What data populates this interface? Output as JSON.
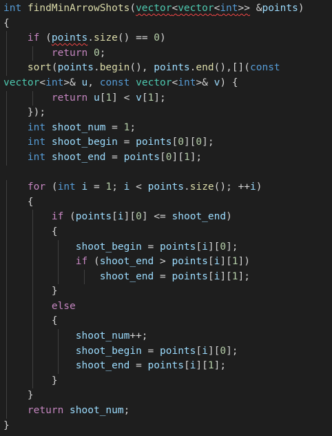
{
  "editor": {
    "language": "cpp",
    "theme": "dark",
    "colors": {
      "background": "#1e1e1e",
      "keyword": "#c586c0",
      "type": "#569cd6",
      "function": "#dcdcaa",
      "variable": "#9cdcfe",
      "number": "#b5cea8",
      "template": "#4ec9b0",
      "text": "#d4d4d4",
      "error_squiggle": "#f44747"
    },
    "lines": [
      {
        "indent": 0,
        "tokens": [
          [
            "type",
            "int"
          ],
          [
            "pun",
            " "
          ],
          [
            "fn",
            "findMinArrowShots"
          ],
          [
            "pun",
            "("
          ],
          [
            "tpl",
            "vector",
            "err"
          ],
          [
            "pun",
            "<",
            "err"
          ],
          [
            "tpl",
            "vector",
            "err"
          ],
          [
            "pun",
            "<",
            "err"
          ],
          [
            "type",
            "int",
            "err"
          ],
          [
            "pun",
            ">>",
            "err"
          ],
          [
            "pun",
            " &"
          ],
          [
            "var",
            "points"
          ],
          [
            "pun",
            ")"
          ]
        ]
      },
      {
        "indent": 0,
        "tokens": [
          [
            "pun",
            "{"
          ]
        ]
      },
      {
        "indent": 1,
        "tokens": [
          [
            "kw",
            "if"
          ],
          [
            "pun",
            " ("
          ],
          [
            "var",
            "points",
            "err"
          ],
          [
            "pun",
            "."
          ],
          [
            "fn",
            "size"
          ],
          [
            "pun",
            "() == "
          ],
          [
            "num",
            "0"
          ],
          [
            "pun",
            ")"
          ]
        ]
      },
      {
        "indent": 2,
        "tokens": [
          [
            "kw",
            "return"
          ],
          [
            "pun",
            " "
          ],
          [
            "num",
            "0"
          ],
          [
            "pun",
            ";"
          ]
        ]
      },
      {
        "indent": 1,
        "tokens": [
          [
            "fn",
            "sort"
          ],
          [
            "pun",
            "("
          ],
          [
            "var",
            "points"
          ],
          [
            "pun",
            "."
          ],
          [
            "fn",
            "begin"
          ],
          [
            "pun",
            "(), "
          ],
          [
            "var",
            "points"
          ],
          [
            "pun",
            "."
          ],
          [
            "fn",
            "end"
          ],
          [
            "pun",
            "(),[]("
          ],
          [
            "type",
            "const"
          ]
        ]
      },
      {
        "indent": 0,
        "tokens": [
          [
            "tpl",
            "vector"
          ],
          [
            "pun",
            "<"
          ],
          [
            "type",
            "int"
          ],
          [
            "pun",
            ">& "
          ],
          [
            "var",
            "u"
          ],
          [
            "pun",
            ", "
          ],
          [
            "type",
            "const"
          ],
          [
            "pun",
            " "
          ],
          [
            "tpl",
            "vector"
          ],
          [
            "pun",
            "<"
          ],
          [
            "type",
            "int"
          ],
          [
            "pun",
            ">& "
          ],
          [
            "var",
            "v"
          ],
          [
            "pun",
            ") {"
          ]
        ]
      },
      {
        "indent": 2,
        "tokens": [
          [
            "kw",
            "return"
          ],
          [
            "pun",
            " "
          ],
          [
            "var",
            "u"
          ],
          [
            "pun",
            "["
          ],
          [
            "num",
            "1"
          ],
          [
            "pun",
            "] < "
          ],
          [
            "var",
            "v"
          ],
          [
            "pun",
            "["
          ],
          [
            "num",
            "1"
          ],
          [
            "pun",
            "];"
          ]
        ]
      },
      {
        "indent": 1,
        "tokens": [
          [
            "pun",
            "});"
          ]
        ]
      },
      {
        "indent": 1,
        "tokens": [
          [
            "type",
            "int"
          ],
          [
            "pun",
            " "
          ],
          [
            "var",
            "shoot_num"
          ],
          [
            "pun",
            " = "
          ],
          [
            "num",
            "1"
          ],
          [
            "pun",
            ";"
          ]
        ]
      },
      {
        "indent": 1,
        "tokens": [
          [
            "type",
            "int"
          ],
          [
            "pun",
            " "
          ],
          [
            "var",
            "shoot_begin"
          ],
          [
            "pun",
            " = "
          ],
          [
            "var",
            "points"
          ],
          [
            "pun",
            "["
          ],
          [
            "num",
            "0"
          ],
          [
            "pun",
            "]["
          ],
          [
            "num",
            "0"
          ],
          [
            "pun",
            "];"
          ]
        ]
      },
      {
        "indent": 1,
        "tokens": [
          [
            "type",
            "int"
          ],
          [
            "pun",
            " "
          ],
          [
            "var",
            "shoot_end"
          ],
          [
            "pun",
            " = "
          ],
          [
            "var",
            "points"
          ],
          [
            "pun",
            "["
          ],
          [
            "num",
            "0"
          ],
          [
            "pun",
            "]["
          ],
          [
            "num",
            "1"
          ],
          [
            "pun",
            "];"
          ]
        ]
      },
      {
        "indent": 0,
        "tokens": []
      },
      {
        "indent": 1,
        "tokens": [
          [
            "kw",
            "for"
          ],
          [
            "pun",
            " ("
          ],
          [
            "type",
            "int"
          ],
          [
            "pun",
            " "
          ],
          [
            "var",
            "i"
          ],
          [
            "pun",
            " = "
          ],
          [
            "num",
            "1"
          ],
          [
            "pun",
            "; "
          ],
          [
            "var",
            "i"
          ],
          [
            "pun",
            " < "
          ],
          [
            "var",
            "points"
          ],
          [
            "pun",
            "."
          ],
          [
            "fn",
            "size"
          ],
          [
            "pun",
            "(); ++"
          ],
          [
            "var",
            "i"
          ],
          [
            "pun",
            ")"
          ]
        ]
      },
      {
        "indent": 1,
        "tokens": [
          [
            "pun",
            "{"
          ]
        ]
      },
      {
        "indent": 2,
        "tokens": [
          [
            "kw",
            "if"
          ],
          [
            "pun",
            " ("
          ],
          [
            "var",
            "points"
          ],
          [
            "pun",
            "["
          ],
          [
            "var",
            "i"
          ],
          [
            "pun",
            "]["
          ],
          [
            "num",
            "0"
          ],
          [
            "pun",
            "] <= "
          ],
          [
            "var",
            "shoot_end"
          ],
          [
            "pun",
            ")"
          ]
        ]
      },
      {
        "indent": 2,
        "tokens": [
          [
            "pun",
            "{"
          ]
        ]
      },
      {
        "indent": 3,
        "tokens": [
          [
            "var",
            "shoot_begin"
          ],
          [
            "pun",
            " = "
          ],
          [
            "var",
            "points"
          ],
          [
            "pun",
            "["
          ],
          [
            "var",
            "i"
          ],
          [
            "pun",
            "]["
          ],
          [
            "num",
            "0"
          ],
          [
            "pun",
            "];"
          ]
        ]
      },
      {
        "indent": 3,
        "tokens": [
          [
            "kw",
            "if"
          ],
          [
            "pun",
            " ("
          ],
          [
            "var",
            "shoot_end"
          ],
          [
            "pun",
            " > "
          ],
          [
            "var",
            "points"
          ],
          [
            "pun",
            "["
          ],
          [
            "var",
            "i"
          ],
          [
            "pun",
            "]["
          ],
          [
            "num",
            "1"
          ],
          [
            "pun",
            "])"
          ]
        ]
      },
      {
        "indent": 4,
        "tokens": [
          [
            "var",
            "shoot_end"
          ],
          [
            "pun",
            " = "
          ],
          [
            "var",
            "points"
          ],
          [
            "pun",
            "["
          ],
          [
            "var",
            "i"
          ],
          [
            "pun",
            "]["
          ],
          [
            "num",
            "1"
          ],
          [
            "pun",
            "];"
          ]
        ]
      },
      {
        "indent": 2,
        "tokens": [
          [
            "pun",
            "}"
          ]
        ]
      },
      {
        "indent": 2,
        "tokens": [
          [
            "kw",
            "else"
          ]
        ]
      },
      {
        "indent": 2,
        "tokens": [
          [
            "pun",
            "{"
          ]
        ]
      },
      {
        "indent": 3,
        "tokens": [
          [
            "var",
            "shoot_num"
          ],
          [
            "pun",
            "++;"
          ]
        ]
      },
      {
        "indent": 3,
        "tokens": [
          [
            "var",
            "shoot_begin"
          ],
          [
            "pun",
            " = "
          ],
          [
            "var",
            "points"
          ],
          [
            "pun",
            "["
          ],
          [
            "var",
            "i"
          ],
          [
            "pun",
            "]["
          ],
          [
            "num",
            "0"
          ],
          [
            "pun",
            "];"
          ]
        ]
      },
      {
        "indent": 3,
        "tokens": [
          [
            "var",
            "shoot_end"
          ],
          [
            "pun",
            " = "
          ],
          [
            "var",
            "points"
          ],
          [
            "pun",
            "["
          ],
          [
            "var",
            "i"
          ],
          [
            "pun",
            "]["
          ],
          [
            "num",
            "1"
          ],
          [
            "pun",
            "];"
          ]
        ]
      },
      {
        "indent": 2,
        "tokens": [
          [
            "pun",
            "}"
          ]
        ]
      },
      {
        "indent": 1,
        "tokens": [
          [
            "pun",
            "}"
          ]
        ]
      },
      {
        "indent": 1,
        "tokens": [
          [
            "kw",
            "return"
          ],
          [
            "pun",
            " "
          ],
          [
            "var",
            "shoot_num"
          ],
          [
            "pun",
            ";"
          ]
        ]
      },
      {
        "indent": 0,
        "tokens": [
          [
            "pun",
            "}"
          ]
        ]
      }
    ]
  }
}
